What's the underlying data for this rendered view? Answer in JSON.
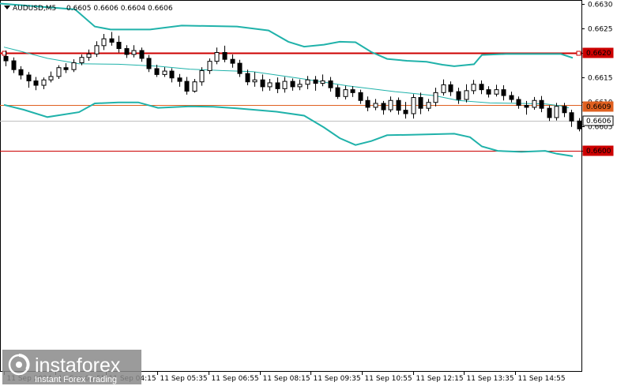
{
  "header": {
    "symbol": "AUDUSD,M5",
    "ohlc": "0.6605 0.6606 0.6604 0.6606"
  },
  "watermark": {
    "brand": "instaforex",
    "tagline": "Instant Forex Trading"
  },
  "chart_data": {
    "type": "candlestick",
    "title": "AUDUSD,M5",
    "ylim": [
      0.65995,
      0.663
    ],
    "y_ticks": [
      "0.6630",
      "0.6625",
      "0.6620",
      "0.6615",
      "0.6610",
      "0.6605",
      "0.6600"
    ],
    "x_ticks": [
      "11 Sep 2024",
      "11 Sep 02:55",
      "11 Sep 04:15",
      "11 Sep 05:35",
      "11 Sep 06:55",
      "11 Sep 08:15",
      "11 Sep 09:35",
      "11 Sep 10:55",
      "11 Sep 12:15",
      "11 Sep 13:35",
      "11 Sep 14:55"
    ],
    "price_tags": [
      "0.6620",
      "0.6609",
      "0.6606",
      "0.6600"
    ],
    "levels": [
      {
        "price": 0.662,
        "color": "#cc0000",
        "label": "0.6620"
      },
      {
        "price": 0.66092,
        "color": "#e06020",
        "label": "0.6609"
      },
      {
        "price": 0.65999,
        "color": "#cc0000",
        "label": "0.6600"
      }
    ],
    "current_price": {
      "price": 0.6606,
      "label": "0.6606",
      "color": "#c0c0c0"
    },
    "colors": {
      "candle": "#000000",
      "bollinger": "#20b2aa",
      "level": "#cc0000",
      "level2": "#e06020"
    },
    "bollinger": {
      "upper": [
        [
          0,
          0.663
        ],
        [
          95,
          0.66288
        ],
        [
          120,
          0.66253
        ],
        [
          140,
          0.66247
        ],
        [
          190,
          0.66247
        ],
        [
          230,
          0.66255
        ],
        [
          300,
          0.66253
        ],
        [
          340,
          0.66245
        ],
        [
          365,
          0.66222
        ],
        [
          385,
          0.66212
        ],
        [
          410,
          0.66216
        ],
        [
          430,
          0.66222
        ],
        [
          450,
          0.66221
        ],
        [
          470,
          0.66201
        ],
        [
          490,
          0.66187
        ],
        [
          515,
          0.66183
        ],
        [
          540,
          0.66181
        ],
        [
          560,
          0.66175
        ],
        [
          575,
          0.66172
        ],
        [
          600,
          0.66176
        ],
        [
          610,
          0.66195
        ],
        [
          640,
          0.66197
        ],
        [
          690,
          0.66197
        ],
        [
          710,
          0.66197
        ],
        [
          725,
          0.66189
        ]
      ],
      "middle": [
        [
          5,
          0.66211
        ],
        [
          20,
          0.66205
        ],
        [
          60,
          0.66188
        ],
        [
          100,
          0.66177
        ],
        [
          150,
          0.66176
        ],
        [
          200,
          0.66172
        ],
        [
          240,
          0.66166
        ],
        [
          280,
          0.66163
        ],
        [
          320,
          0.66161
        ],
        [
          380,
          0.66147
        ],
        [
          440,
          0.66132
        ],
        [
          500,
          0.6612
        ],
        [
          550,
          0.66112
        ],
        [
          580,
          0.66102
        ],
        [
          620,
          0.66097
        ],
        [
          660,
          0.66096
        ],
        [
          690,
          0.66095
        ],
        [
          710,
          0.66091
        ],
        [
          720,
          0.66087
        ]
      ],
      "lower": [
        [
          5,
          0.66093
        ],
        [
          30,
          0.66083
        ],
        [
          60,
          0.66068
        ],
        [
          100,
          0.66078
        ],
        [
          120,
          0.66096
        ],
        [
          150,
          0.66098
        ],
        [
          175,
          0.66098
        ],
        [
          200,
          0.66087
        ],
        [
          240,
          0.6609
        ],
        [
          270,
          0.66089
        ],
        [
          300,
          0.66086
        ],
        [
          350,
          0.66079
        ],
        [
          385,
          0.66071
        ],
        [
          410,
          0.66047
        ],
        [
          430,
          0.66025
        ],
        [
          450,
          0.66011
        ],
        [
          470,
          0.66019
        ],
        [
          490,
          0.66031
        ],
        [
          520,
          0.66032
        ],
        [
          550,
          0.66033
        ],
        [
          575,
          0.66034
        ],
        [
          595,
          0.66027
        ],
        [
          610,
          0.66008
        ],
        [
          630,
          0.65999
        ],
        [
          660,
          0.65997
        ],
        [
          690,
          0.65999
        ],
        [
          705,
          0.65993
        ],
        [
          725,
          0.65988
        ]
      ]
    },
    "candles": [
      [
        0.66192,
        0.66183,
        0.66204,
        0.66172
      ],
      [
        0.66183,
        0.66165,
        0.6619,
        0.66158
      ],
      [
        0.66165,
        0.66154,
        0.66172,
        0.66145
      ],
      [
        0.66154,
        0.66142,
        0.6616,
        0.66128
      ],
      [
        0.66142,
        0.66133,
        0.6615,
        0.66123
      ],
      [
        0.66133,
        0.66144,
        0.66149,
        0.66125
      ],
      [
        0.66144,
        0.66151,
        0.66161,
        0.66139
      ],
      [
        0.66151,
        0.66169,
        0.66174,
        0.66146
      ],
      [
        0.66169,
        0.66165,
        0.66178,
        0.66158
      ],
      [
        0.66165,
        0.66179,
        0.66186,
        0.6616
      ],
      [
        0.66179,
        0.6619,
        0.66196,
        0.66174
      ],
      [
        0.6619,
        0.66197,
        0.66206,
        0.66183
      ],
      [
        0.66197,
        0.66214,
        0.66223,
        0.66191
      ],
      [
        0.66214,
        0.66228,
        0.66238,
        0.66205
      ],
      [
        0.66228,
        0.66221,
        0.66242,
        0.66214
      ],
      [
        0.66221,
        0.66208,
        0.66234,
        0.662
      ],
      [
        0.66208,
        0.66196,
        0.66215,
        0.66189
      ],
      [
        0.66196,
        0.66204,
        0.66215,
        0.6619
      ],
      [
        0.66204,
        0.66188,
        0.6621,
        0.66181
      ],
      [
        0.66188,
        0.66167,
        0.66195,
        0.6616
      ],
      [
        0.66167,
        0.66155,
        0.66175,
        0.6615
      ],
      [
        0.66155,
        0.66162,
        0.6617,
        0.6615
      ],
      [
        0.66162,
        0.66148,
        0.66168,
        0.66139
      ],
      [
        0.66148,
        0.66141,
        0.66156,
        0.6613
      ],
      [
        0.66141,
        0.66121,
        0.6615,
        0.66114
      ],
      [
        0.66121,
        0.6614,
        0.66146,
        0.66118
      ],
      [
        0.6614,
        0.66163,
        0.6617,
        0.66132
      ],
      [
        0.66163,
        0.66182,
        0.66188,
        0.66156
      ],
      [
        0.66182,
        0.662,
        0.6621,
        0.66176
      ],
      [
        0.662,
        0.66186,
        0.66214,
        0.6618
      ],
      [
        0.66186,
        0.66178,
        0.66196,
        0.66169
      ],
      [
        0.66178,
        0.66157,
        0.66185,
        0.6615
      ],
      [
        0.66157,
        0.6614,
        0.66165,
        0.66133
      ],
      [
        0.6614,
        0.66144,
        0.6616,
        0.6613
      ],
      [
        0.66144,
        0.6613,
        0.66155,
        0.66121
      ],
      [
        0.6613,
        0.66138,
        0.66146,
        0.66122
      ],
      [
        0.66138,
        0.66126,
        0.66149,
        0.66117
      ],
      [
        0.66126,
        0.66141,
        0.6615,
        0.66118
      ],
      [
        0.66141,
        0.6613,
        0.66147,
        0.66122
      ],
      [
        0.6613,
        0.66135,
        0.66145,
        0.66123
      ],
      [
        0.66135,
        0.66144,
        0.66152,
        0.66125
      ],
      [
        0.66144,
        0.66137,
        0.66152,
        0.66122
      ],
      [
        0.66137,
        0.66142,
        0.66155,
        0.66131
      ],
      [
        0.66142,
        0.66128,
        0.6615,
        0.6612
      ],
      [
        0.66128,
        0.6611,
        0.66134,
        0.66105
      ],
      [
        0.6611,
        0.66124,
        0.66132,
        0.66104
      ],
      [
        0.66124,
        0.66118,
        0.66131,
        0.66109
      ],
      [
        0.66118,
        0.66102,
        0.66124,
        0.66095
      ],
      [
        0.66102,
        0.66088,
        0.6611,
        0.6608
      ],
      [
        0.66088,
        0.66096,
        0.66105,
        0.66082
      ],
      [
        0.66096,
        0.66083,
        0.66101,
        0.66073
      ],
      [
        0.66083,
        0.66102,
        0.6611,
        0.66078
      ],
      [
        0.66102,
        0.66082,
        0.66108,
        0.66073
      ],
      [
        0.66082,
        0.66075,
        0.66099,
        0.66065
      ],
      [
        0.66075,
        0.66108,
        0.66115,
        0.66065
      ],
      [
        0.66108,
        0.66086,
        0.66118,
        0.66074
      ],
      [
        0.66086,
        0.66098,
        0.66105,
        0.6608
      ],
      [
        0.66098,
        0.66118,
        0.66128,
        0.6609
      ],
      [
        0.66118,
        0.66134,
        0.66145,
        0.66112
      ],
      [
        0.66134,
        0.6612,
        0.66141,
        0.66111
      ],
      [
        0.6612,
        0.66104,
        0.66128,
        0.66095
      ],
      [
        0.66104,
        0.66122,
        0.66135,
        0.66098
      ],
      [
        0.66122,
        0.66135,
        0.66144,
        0.66115
      ],
      [
        0.66135,
        0.66124,
        0.66143,
        0.66115
      ],
      [
        0.66124,
        0.66115,
        0.66131,
        0.66108
      ],
      [
        0.66115,
        0.66124,
        0.66134,
        0.6611
      ],
      [
        0.66124,
        0.66112,
        0.66133,
        0.66102
      ],
      [
        0.66112,
        0.66104,
        0.6612,
        0.66098
      ],
      [
        0.66104,
        0.66092,
        0.6611,
        0.66085
      ],
      [
        0.66092,
        0.66088,
        0.66101,
        0.66073
      ],
      [
        0.66088,
        0.66102,
        0.66109,
        0.66083
      ],
      [
        0.66102,
        0.66086,
        0.66111,
        0.66078
      ],
      [
        0.66086,
        0.66067,
        0.66092,
        0.6606
      ],
      [
        0.66067,
        0.6609,
        0.66097,
        0.66061
      ],
      [
        0.6609,
        0.66077,
        0.66097,
        0.66068
      ],
      [
        0.66077,
        0.6606,
        0.66083,
        0.66048
      ],
      [
        0.6606,
        0.66044,
        0.66066,
        0.66039
      ]
    ]
  }
}
